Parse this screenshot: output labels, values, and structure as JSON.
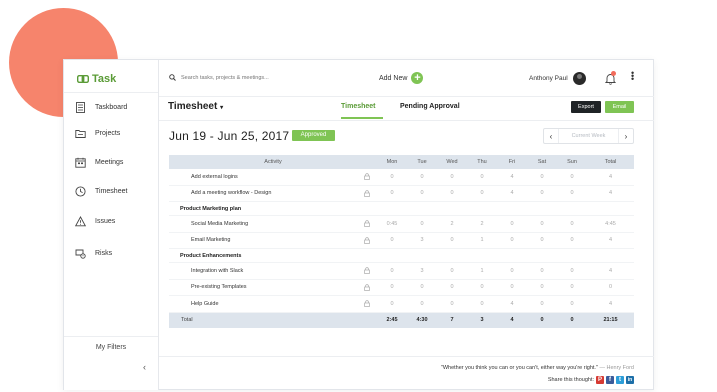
{
  "brand": {
    "name": "Task",
    "accent": "#7fc454",
    "dark": "#1f2326",
    "blob": "#f6846c"
  },
  "sidebar": {
    "items": [
      {
        "label": "Taskboard",
        "icon": "taskboard-icon"
      },
      {
        "label": "Projects",
        "icon": "folder-icon"
      },
      {
        "label": "Meetings",
        "icon": "calendar-icon"
      },
      {
        "label": "Timesheet",
        "icon": "clock-icon"
      },
      {
        "label": "Issues",
        "icon": "warning-icon"
      },
      {
        "label": "Risks",
        "icon": "risk-icon"
      }
    ],
    "filters_label": "My Filters",
    "collapse_label": "‹"
  },
  "topbar": {
    "search_placeholder": "Search tasks, projects & meetings...",
    "add_new_label": "Add New",
    "user_name": "Anthony Paul"
  },
  "subbar": {
    "title": "Timesheet",
    "tabs": [
      {
        "label": "Timesheet",
        "active": true
      },
      {
        "label": "Pending Approval",
        "active": false
      }
    ],
    "export_label": "Export",
    "email_label": "Email"
  },
  "week": {
    "range": "Jun 19 - Jun 25, 2017",
    "status": "Approved",
    "current_week_label": "Current Week"
  },
  "table": {
    "headers": [
      "Activity",
      "Mon",
      "Tue",
      "Wed",
      "Thu",
      "Fri",
      "Sat",
      "Sun",
      "Total"
    ],
    "rows": [
      {
        "type": "item",
        "name": "Add external logins",
        "values": [
          "0",
          "0",
          "0",
          "0",
          "4",
          "0",
          "0",
          "4"
        ]
      },
      {
        "type": "item",
        "name": "Add a meeting workflow - Design",
        "values": [
          "0",
          "0",
          "0",
          "0",
          "4",
          "0",
          "0",
          "4"
        ]
      },
      {
        "type": "section",
        "name": "Product Marketing plan"
      },
      {
        "type": "item",
        "name": "Social Media Marketing",
        "values": [
          "0:45",
          "0",
          "2",
          "2",
          "0",
          "0",
          "0",
          "4:45"
        ]
      },
      {
        "type": "item",
        "name": "Email Marketing",
        "values": [
          "0",
          "3",
          "0",
          "1",
          "0",
          "0",
          "0",
          "4"
        ]
      },
      {
        "type": "section",
        "name": "Product Enhancements"
      },
      {
        "type": "item",
        "name": "Integration with Slack",
        "values": [
          "0",
          "3",
          "0",
          "1",
          "0",
          "0",
          "0",
          "4"
        ]
      },
      {
        "type": "item",
        "name": "Pre-existing Templates",
        "values": [
          "0",
          "0",
          "0",
          "0",
          "0",
          "0",
          "0",
          "0"
        ]
      },
      {
        "type": "item",
        "name": "Help Guide",
        "values": [
          "0",
          "0",
          "0",
          "0",
          "4",
          "0",
          "0",
          "4"
        ]
      }
    ],
    "total": {
      "label": "Total",
      "values": [
        "2:45",
        "4:30",
        "7",
        "3",
        "4",
        "0",
        "0",
        "21:15"
      ]
    }
  },
  "footer": {
    "quote": "\"Whether you think you can or you can't, either way you're right.\"",
    "author": "— Henry Ford",
    "share_label": "Share this thought:",
    "social": [
      {
        "icon": "pinterest-icon",
        "glyph": "P",
        "color": "#d63a33"
      },
      {
        "icon": "facebook-icon",
        "glyph": "f",
        "color": "#3b5b9a"
      },
      {
        "icon": "twitter-icon",
        "glyph": "t",
        "color": "#2d9ed8"
      },
      {
        "icon": "linkedin-icon",
        "glyph": "in",
        "color": "#1d6fa8"
      }
    ]
  }
}
